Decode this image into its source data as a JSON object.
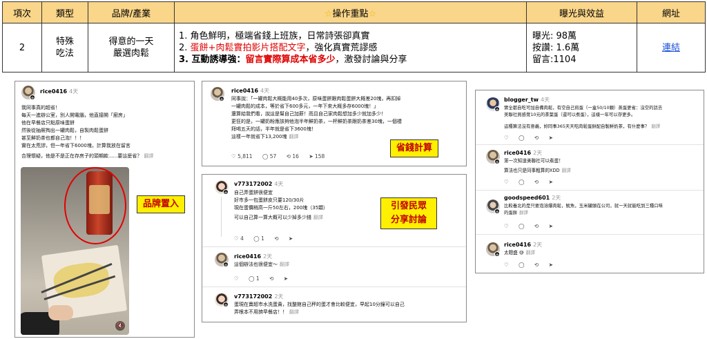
{
  "table": {
    "headers": {
      "item": "項次",
      "type": "類型",
      "brand": "品牌/產業",
      "ops": "操作重點",
      "exposure": "曝光與效益",
      "url": "網址"
    },
    "row": {
      "item": "2",
      "type_line1": "特殊",
      "type_line2": "吃法",
      "brand_line1": "得意的一天",
      "brand_line2": "嚴選肉鬆",
      "ops_1": "1. 角色鮮明，極端省錢上班族，日常詩張卻真實",
      "ops_2a": "2. ",
      "ops_2b": "蛋餅+肉鬆實拍影片搭配文字",
      "ops_2c": "，強化真實荒謬感",
      "ops_3a": "3. ",
      "ops_3b": "互動誘導強：",
      "ops_3c": "留言實際算成本省多少",
      "ops_3d": "，激發討論與分享",
      "exp_1": "曝光: 98萬",
      "exp_2": "按讚: 1.6萬",
      "exp_3": "留言:1104",
      "url_text": "連結"
    }
  },
  "panel1": {
    "username": "rice0416",
    "time": "4天",
    "lines": [
      "我同事真的超省！",
      "每天一進辦公室，別人開電腦，他直接開「廚房」",
      "他在早餐店只點原味蛋餅",
      "然後從抽屜掏出一罐肉鬆，自製肉鬆蛋餅",
      "甚至鮮奶茶也都自己泡！！！",
      "實在太荒謬，但一年省下6000塊，計算我放在留言"
    ],
    "extra": "合理懷疑，他是不是正在存房子的頭期款......要這麼省？",
    "translate": "翻譯",
    "callout": "品牌置入"
  },
  "panel2": {
    "username": "rice0416",
    "time": "4天",
    "lines": [
      "同事說：「一罐肉鬆大概能用40多次，原味蛋餅跟肉鬆蛋餅大概差20塊，再扣掉",
      "一罐肉鬆的成本，等於省下600多元，一年下來大概多存6000塊！」",
      "還算給我們看，說這是幫自己加薪！而且自己家肉鬆想加多少就加多少！",
      "更狂的是，一罐奶粉應該夠他泡半年鮮奶茶，一杯鮮奶茶跟奶茶差30塊，一個禮",
      "拜喝五天的話，半年就是省下3600塊！"
    ],
    "last": "這樣一年就省下13,200塊",
    "translate": "翻譯",
    "likes": "5,811",
    "comments": "57",
    "reposts": "16",
    "shares": "158",
    "callout": "省錢計算"
  },
  "panel3": {
    "c1": {
      "username": "v773172002",
      "time": "4天",
      "lines": [
        "自己弄蛋餅很便宜",
        "好市多一包蛋餅皮只要120/30片",
        "現在蛋價稍高一斤50左右，200塊（35顆）"
      ],
      "last": "可以自己算一算大概可以少掉多少錢",
      "translate": "翻譯",
      "likes": "4",
      "comments": "1"
    },
    "c2": {
      "username": "rice0416",
      "time": "2天",
      "text": "這個辦法也很便宜～",
      "translate": "翻譯",
      "comments": "1"
    },
    "c3": {
      "username": "v773172002",
      "time": "2天",
      "line1": "蛋現在賣超市水洗蛋貴，找整館自己秤的蛋才會比較便宜，早起10分鐘可以自己",
      "line2": "弄根本不用擠早餐店！！",
      "translate": "翻譯"
    },
    "callout_1": "引發民眾",
    "callout_2": "分享討論"
  },
  "panel4": {
    "c1": {
      "username": "blogger_tw",
      "time": "4天",
      "line1": "實全都自吃可加自備肉鬆，有空自己煎蛋（一盒50/10顆）蒸蛋更省：沒空的話去",
      "line2": "美聯社買感覺10元的茶葉蛋（還可以煮蛋），這樣一年可以存更多。",
      "line3": "這種算法沒有意義，妳同事365天天吃肉鬆蛋餅配自製鮮奶茶，有什麼事？",
      "translate": "翻譯"
    },
    "c2": {
      "username": "rice0416",
      "time": "2天",
      "line1": "第一次知道美聯社可以煮蛋！",
      "line2": "算法也只是同事粗算的XDD",
      "translate": "翻譯"
    },
    "c3": {
      "username": "goodspeed601",
      "time": "2天",
      "line1": "比較養北的是只要泡溶爆肉鬆，魷魚，玉米罐頭在公司，就一天就能吃到三種口味",
      "line2": "的蛋餅",
      "translate": "翻譯"
    },
    "c4": {
      "username": "rice0416",
      "time": "2天",
      "text": "太聰盛",
      "translate": "翻譯"
    }
  }
}
